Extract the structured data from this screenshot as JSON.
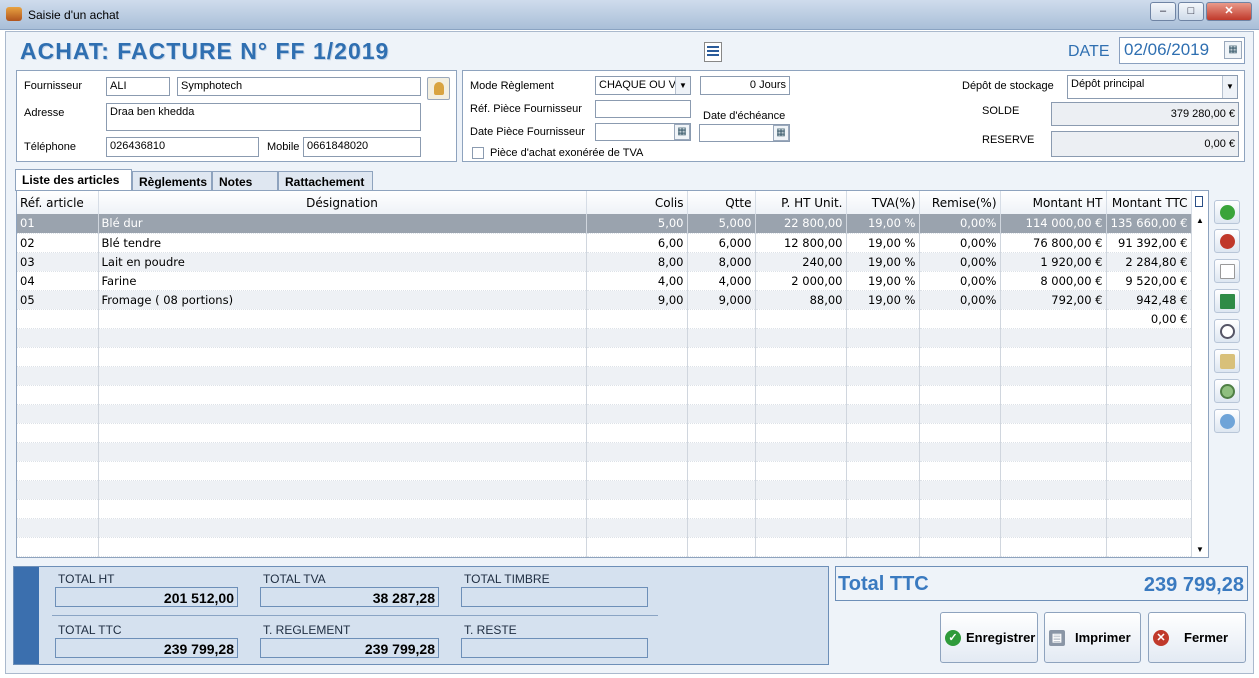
{
  "window": {
    "title": "Saisie d'un achat",
    "buttons": [
      "–",
      "□",
      "✕"
    ]
  },
  "header": {
    "title": "ACHAT: FACTURE N° FF 1/2019",
    "date_label": "DATE",
    "date_value": "02/06/2019"
  },
  "supplier": {
    "fournisseur_label": "Fournisseur",
    "code": "ALI",
    "name": "Symphotech",
    "adresse_label": "Adresse",
    "adresse": "Draa ben khedda",
    "telephone_label": "Téléphone",
    "telephone": "026436810",
    "mobile_label": "Mobile",
    "mobile": "0661848020"
  },
  "payment": {
    "mode_label": "Mode Règlement",
    "mode_value": "CHAQUE OU V",
    "jours_value": "0 Jours",
    "ref_label": "Réf. Pièce Fournisseur",
    "ref_value": "",
    "date_echeance_label": "Date d'échéance",
    "date_echeance_value": "",
    "date_piece_label": "Date Pièce Fournisseur",
    "date_piece_value": "",
    "exonere_label": "Pièce d'achat exonérée de TVA",
    "exonere_checked": false
  },
  "stock": {
    "depot_label": "Dépôt de stockage",
    "depot_value": "Dépôt principal",
    "solde_label": "SOLDE",
    "solde_value": "379 280,00 €",
    "reserve_label": "RESERVE",
    "reserve_value": "0,00 €"
  },
  "tabs": [
    "Liste des articles",
    "Règlements",
    "Notes",
    "Rattachement"
  ],
  "grid": {
    "columns": [
      "Réf. article",
      "Désignation",
      "Colis",
      "Qtte",
      "P. HT Unit.",
      "TVA(%)",
      "Remise(%)",
      "Montant HT",
      "Montant TTC"
    ],
    "rows": [
      [
        "01",
        "Blé dur",
        "5,00",
        "5,000",
        "22 800,00",
        "19,00 %",
        "0,00%",
        "114 000,00 €",
        "135 660,00 €"
      ],
      [
        "02",
        "Blé tendre",
        "6,00",
        "6,000",
        "12 800,00",
        "19,00 %",
        "0,00%",
        "76 800,00 €",
        "91 392,00 €"
      ],
      [
        "03",
        "Lait en poudre",
        "8,00",
        "8,000",
        "240,00",
        "19,00 %",
        "0,00%",
        "1 920,00 €",
        "2 284,80 €"
      ],
      [
        "04",
        "Farine",
        "4,00",
        "4,000",
        "2 000,00",
        "19,00 %",
        "0,00%",
        "8 000,00 €",
        "9 520,00 €"
      ],
      [
        "05",
        "Fromage ( 08 portions)",
        "9,00",
        "9,000",
        "88,00",
        "19,00 %",
        "0,00%",
        "792,00 €",
        "942,48 €"
      ],
      [
        "",
        "",
        "",
        "",
        "",
        "",
        "",
        "",
        "0,00 €"
      ]
    ],
    "empty_rows": 13,
    "selected_row": 0
  },
  "side_tools": [
    "add-icon",
    "remove-icon",
    "new-document-icon",
    "excel-icon",
    "search-icon",
    "edit-icon",
    "settings-icon",
    "refresh-icon"
  ],
  "totals": {
    "total_ht_label": "TOTAL HT",
    "total_ht": "201 512,00",
    "total_tva_label": "TOTAL  TVA",
    "total_tva": "38 287,28",
    "total_timbre_label": "TOTAL TIMBRE",
    "total_timbre": "",
    "total_ttc_label": "TOTAL TTC",
    "total_ttc": "239 799,28",
    "t_reglement_label": "T. REGLEMENT",
    "t_reglement": "239 799,28",
    "t_reste_label": "T. RESTE",
    "t_reste": ""
  },
  "total_ttc_panel": {
    "label": "Total TTC",
    "value": "239 799,28"
  },
  "actions": {
    "save": "Enregistrer",
    "print": "Imprimer",
    "close": "Fermer"
  },
  "colors": {
    "accent": "#2f6fb1",
    "selected_row": "#9aa3ae",
    "totals_bg": "#d5e1ef"
  }
}
